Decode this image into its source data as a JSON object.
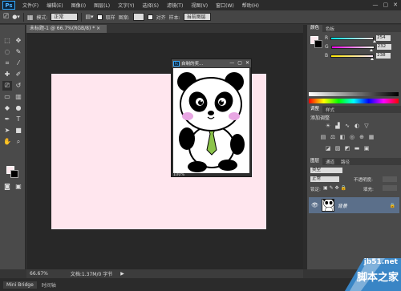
{
  "app": {
    "logo": "Ps"
  },
  "menu": [
    "文件(F)",
    "编辑(E)",
    "图像(I)",
    "图层(L)",
    "文字(Y)",
    "选择(S)",
    "滤镜(T)",
    "视图(V)",
    "窗口(W)",
    "帮助(H)"
  ],
  "window_controls": [
    "—",
    "▢",
    "✕"
  ],
  "options": {
    "mode_label": "模式:",
    "mode_value": "正常",
    "sample_check_label": "取样",
    "flow_label": "图案:",
    "align_label": "对齐",
    "sample_label": "样本:",
    "sample_value": "当前图层"
  },
  "doc_tab": "未标题-1 @ 66.7%(RGB/8) *  ×",
  "float_window": {
    "title": "自制的奖...",
    "zoom": "100%"
  },
  "status": {
    "zoom": "66.67%",
    "doc_info": "文档:1.37M/0 字节"
  },
  "bottom_tabs": [
    "Mini Bridge",
    "时间轴"
  ],
  "color_panel": {
    "tabs": [
      "颜色",
      "色板"
    ],
    "channels": [
      {
        "name": "R",
        "value": "254",
        "fraction": 0.996
      },
      {
        "name": "G",
        "value": "232",
        "fraction": 0.91
      },
      {
        "name": "B",
        "value": "238",
        "fraction": 0.933
      }
    ]
  },
  "adjust_panel": {
    "tabs": [
      "调整",
      "样式"
    ],
    "title": "添加调整"
  },
  "layers_panel": {
    "tabs": [
      "图层",
      "通道",
      "路径"
    ],
    "kind_label": "类型",
    "blend_value": "正常",
    "opacity_label": "不透明度:",
    "lock_label": "锁定:",
    "fill_label": "填充:",
    "layer_name": "背景"
  },
  "watermark": {
    "line1": "jb51.net",
    "line2": "脚本之家"
  },
  "colors": {
    "foreground": "#fde9ee",
    "background": "#000000",
    "canvas": "#ffe6ee",
    "accent": "#31a8ff"
  }
}
